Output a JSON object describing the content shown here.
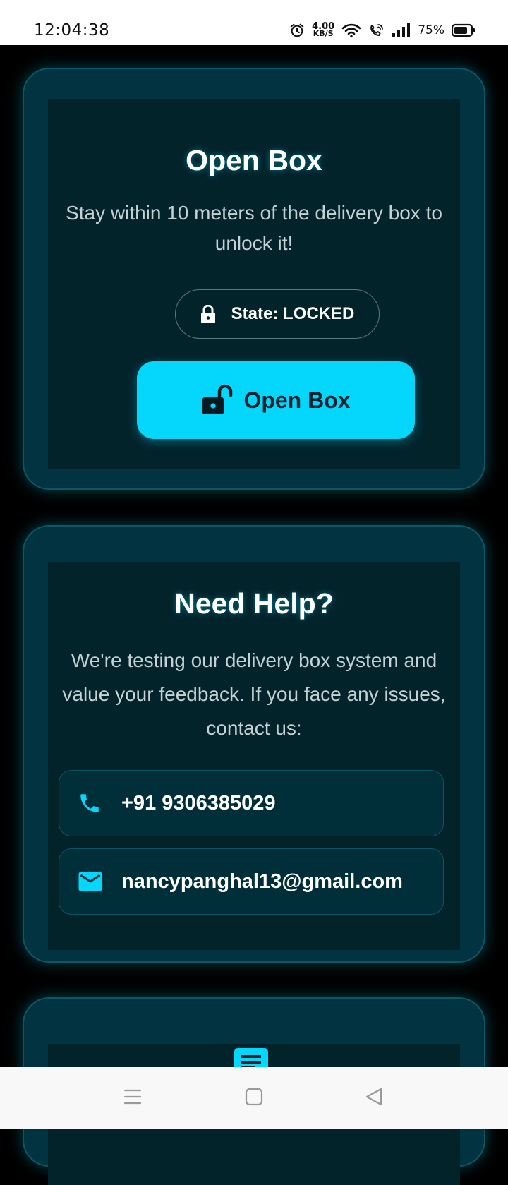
{
  "status_bar": {
    "time": "12:04:38",
    "net_speed_value": "4.00",
    "net_speed_unit": "KB/S",
    "battery": "75%",
    "icons": [
      "alarm-icon",
      "wifi-icon",
      "volte-call-icon",
      "signal-icon",
      "battery-icon"
    ]
  },
  "open_box_card": {
    "title": "Open Box",
    "description": "Stay within 10 meters of the delivery box to unlock it!",
    "state_label": "State: LOCKED",
    "state_icon": "lock-icon",
    "button_label": "Open Box",
    "button_icon": "lock-open-icon"
  },
  "help_card": {
    "title": "Need Help?",
    "description": "We're testing our delivery box system and value your feedback. If you face any issues, contact us:",
    "phone": "+91 9306385029",
    "email": "nancypanghal13@gmail.com"
  },
  "third_card": {
    "icon": "notes-icon"
  },
  "nav_bar": {
    "buttons": [
      "menu-icon",
      "home-icon",
      "back-icon"
    ]
  },
  "colors": {
    "accent": "#05d6fb",
    "card_border": "#0b5767",
    "card_bg": "#013340",
    "inner_bg": "#03232b",
    "page_bg": "#000000"
  }
}
